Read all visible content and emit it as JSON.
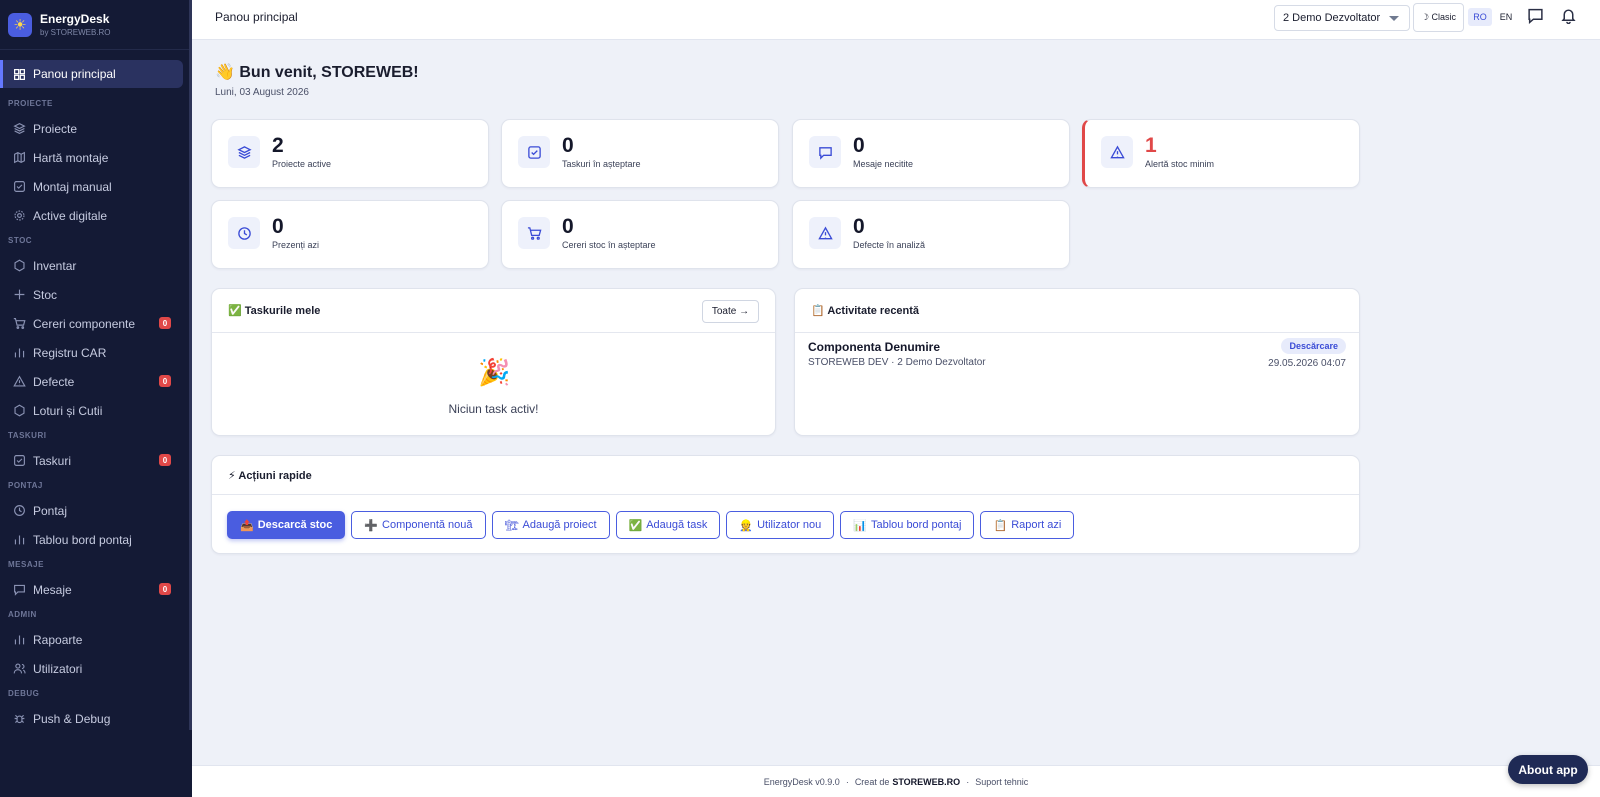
{
  "brand": {
    "name": "EnergyDesk",
    "sub": "by STOREWEB.RO"
  },
  "sidebar": {
    "active": "Panou principal",
    "sections": [
      {
        "title": "PROIECTE",
        "items": [
          {
            "label": "Proiecte",
            "icon": "layers-icon"
          },
          {
            "label": "Hartă montaje",
            "icon": "map-icon"
          },
          {
            "label": "Montaj manual",
            "icon": "check-square-icon"
          },
          {
            "label": "Active digitale",
            "icon": "gear-icon"
          }
        ]
      },
      {
        "title": "STOC",
        "items": [
          {
            "label": "Inventar",
            "icon": "hexagon-icon"
          },
          {
            "label": "Stoc",
            "icon": "plus-icon"
          },
          {
            "label": "Cereri componente",
            "icon": "cart-icon",
            "badge": "0"
          },
          {
            "label": "Registru CAR",
            "icon": "bar-chart-icon"
          },
          {
            "label": "Defecte",
            "icon": "warning-icon",
            "badge": "0"
          },
          {
            "label": "Loturi și Cutii",
            "icon": "hexagon-icon"
          }
        ]
      },
      {
        "title": "TASKURI",
        "items": [
          {
            "label": "Taskuri",
            "icon": "check-square-icon",
            "badge": "0"
          }
        ]
      },
      {
        "title": "PONTAJ",
        "items": [
          {
            "label": "Pontaj",
            "icon": "clock-icon"
          },
          {
            "label": "Tablou bord pontaj",
            "icon": "bar-chart-icon"
          }
        ]
      },
      {
        "title": "MESAJE",
        "items": [
          {
            "label": "Mesaje",
            "icon": "message-icon",
            "badge": "0"
          }
        ]
      },
      {
        "title": "ADMIN",
        "items": [
          {
            "label": "Rapoarte",
            "icon": "bar-chart-icon"
          },
          {
            "label": "Utilizatori",
            "icon": "users-icon"
          }
        ]
      },
      {
        "title": "DEBUG",
        "items": [
          {
            "label": "Push & Debug",
            "icon": "bug-icon"
          }
        ]
      }
    ]
  },
  "header": {
    "title": "Panou principal",
    "company_select": "2 Demo Dezvoltator",
    "theme_label": "☽ Clasic",
    "lang_ro": "RO",
    "lang_en": "EN"
  },
  "welcome": {
    "title": "👋 Bun venit, STOREWEB!",
    "date": "Luni, 03 August 2026"
  },
  "stats": [
    {
      "value": "2",
      "label": "Proiecte active",
      "icon": "layers-icon"
    },
    {
      "value": "0",
      "label": "Taskuri în așteptare",
      "icon": "check-square-icon"
    },
    {
      "value": "0",
      "label": "Mesaje necitite",
      "icon": "message-icon"
    },
    {
      "value": "1",
      "label": "Alertă stoc minim",
      "icon": "warning-icon",
      "alert": true
    },
    {
      "value": "0",
      "label": "Prezenți azi",
      "icon": "clock-icon"
    },
    {
      "value": "0",
      "label": "Cereri stoc în așteptare",
      "icon": "cart-icon"
    },
    {
      "value": "0",
      "label": "Defecte în analiză",
      "icon": "warning-icon"
    }
  ],
  "tasks_panel": {
    "title": "✅ Taskurile mele",
    "all_button": "Toate →",
    "empty_text": "Niciun task activ!",
    "empty_icon": "🎉"
  },
  "activity_panel": {
    "title": "📋 Activitate recentă",
    "items": [
      {
        "title": "Componenta Denumire",
        "sub": "STOREWEB DEV · 2 Demo Dezvoltator",
        "badge": "Descărcare",
        "time": "29.05.2026 04:07"
      }
    ]
  },
  "quick_actions": {
    "title": "⚡ Acțiuni rapide",
    "buttons": [
      {
        "icon": "📤",
        "label": "Descarcă stoc",
        "primary": true
      },
      {
        "icon": "➕",
        "label": "Componentă nouă"
      },
      {
        "icon": "🏗",
        "label": "Adaugă proiect"
      },
      {
        "icon": "✅",
        "label": "Adaugă task"
      },
      {
        "icon": "👷",
        "label": "Utilizator nou"
      },
      {
        "icon": "📊",
        "label": "Tablou bord pontaj"
      },
      {
        "icon": "📋",
        "label": "Raport azi"
      }
    ]
  },
  "footer": {
    "version": "EnergyDesk v0.9.0",
    "created_by_prefix": "Creat de",
    "created_by": "STOREWEB.RO",
    "support": "Suport tehnic",
    "sep": "·"
  },
  "about_button": "About app",
  "colors": {
    "sidebar_bg": "#141a35",
    "accent": "#4a5de0",
    "alert": "#e04848",
    "page_bg": "#eef1f8"
  }
}
